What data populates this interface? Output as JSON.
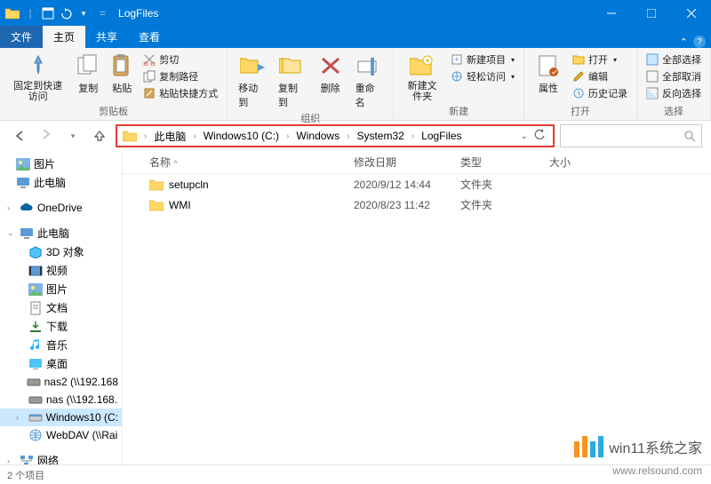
{
  "titlebar": {
    "title": "LogFiles"
  },
  "tabs": {
    "file": "文件",
    "home": "主页",
    "share": "共享",
    "view": "查看"
  },
  "ribbon": {
    "pin": "固定到快速访问",
    "copy": "复制",
    "paste": "粘贴",
    "cut": "剪切",
    "copyPath": "复制路径",
    "pasteShortcut": "粘贴快捷方式",
    "moveTo": "移动到",
    "copyTo": "复制到",
    "delete": "删除",
    "rename": "重命名",
    "newFolder": "新建文件夹",
    "newItem": "新建项目",
    "easyAccess": "轻松访问",
    "properties": "属性",
    "open": "打开",
    "edit": "编辑",
    "history": "历史记录",
    "selectAll": "全部选择",
    "selectNone": "全部取消",
    "invert": "反向选择",
    "groups": {
      "clipboard": "剪贴板",
      "organize": "组织",
      "new": "新建",
      "open": "打开",
      "select": "选择"
    }
  },
  "breadcrumb": {
    "items": [
      "此电脑",
      "Windows10 (C:)",
      "Windows",
      "System32",
      "LogFiles"
    ]
  },
  "columns": {
    "name": "名称",
    "date": "修改日期",
    "type": "类型",
    "size": "大小"
  },
  "files": [
    {
      "name": "setupcln",
      "date": "2020/9/12 14:44",
      "type": "文件夹",
      "size": ""
    },
    {
      "name": "WMI",
      "date": "2020/8/23 11:42",
      "type": "文件夹",
      "size": ""
    }
  ],
  "nav": {
    "pictures": "图片",
    "thisPCTop": "此电脑",
    "onedrive": "OneDrive",
    "thisPC": "此电脑",
    "objects3d": "3D 对象",
    "videos": "视频",
    "picturesSub": "图片",
    "documents": "文档",
    "downloads": "下载",
    "music": "音乐",
    "desktop": "桌面",
    "nas2": "nas2 (\\\\192.168",
    "nas": "nas (\\\\192.168.",
    "windows10c": "Windows10 (C:",
    "webdav": "WebDAV (\\\\Rai",
    "network": "网络"
  },
  "status": {
    "count": "2 个项目"
  },
  "watermark": {
    "text": "win11系统之家",
    "url": "www.relsound.com"
  }
}
